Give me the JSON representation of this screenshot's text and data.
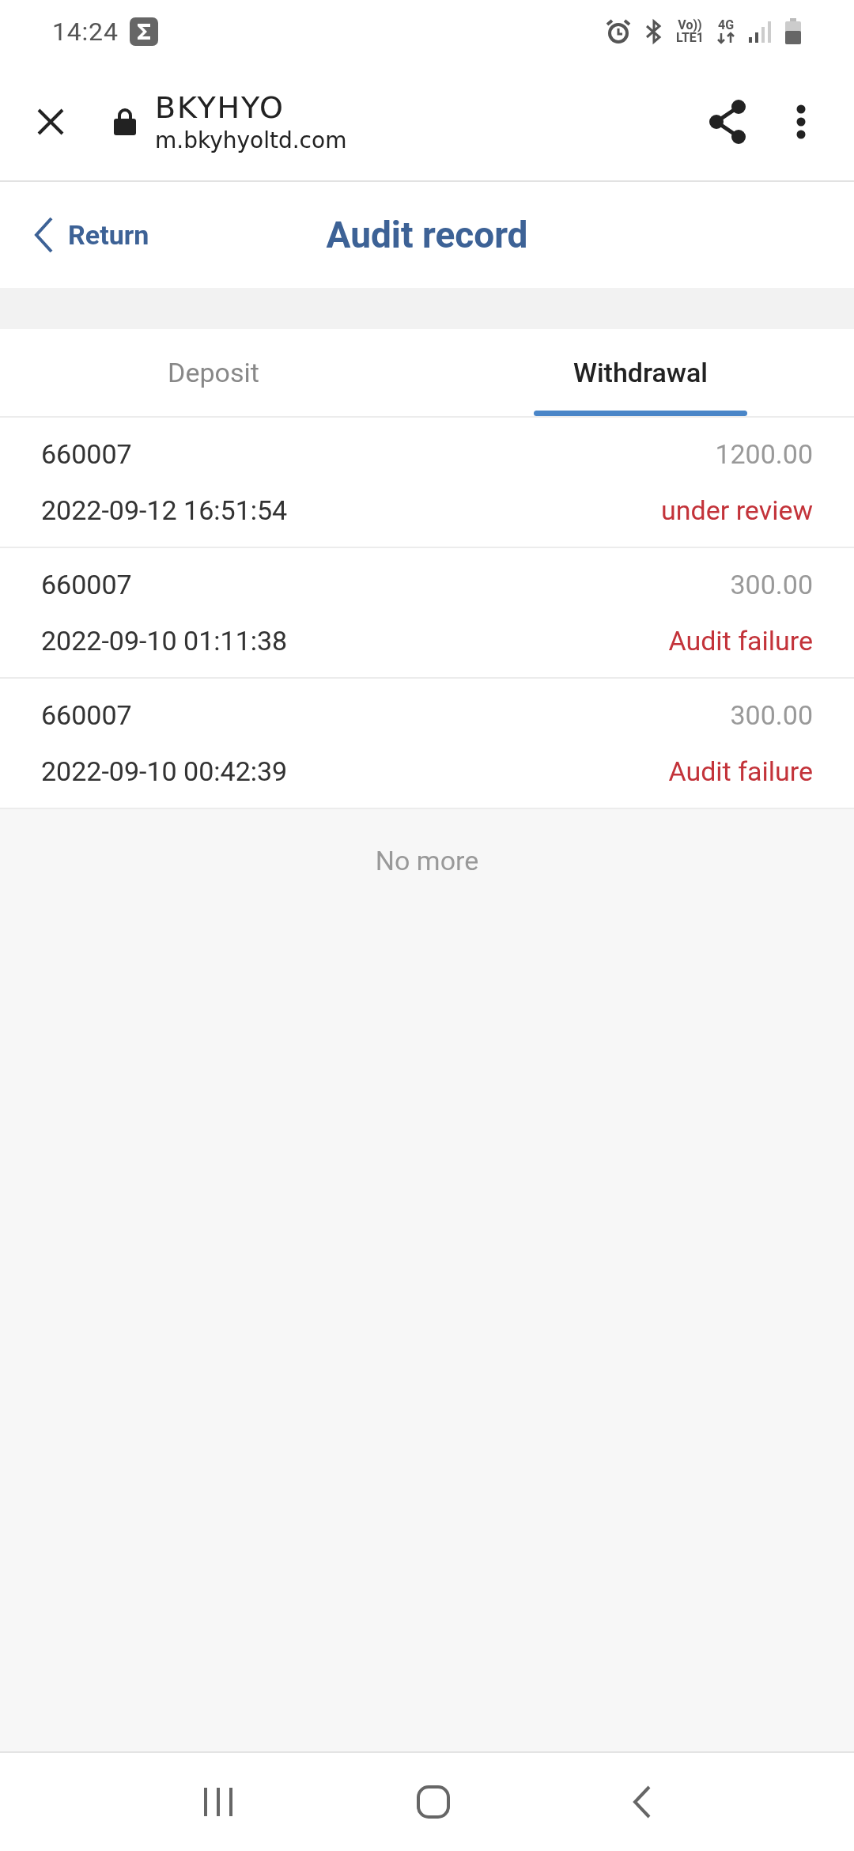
{
  "status_bar": {
    "time": "14:24",
    "volte": "Vo))",
    "lte": "LTE1",
    "network": "4G"
  },
  "browser_bar": {
    "title": "BKYHYO",
    "url": "m.bkyhyoltd.com"
  },
  "header": {
    "back": "Return",
    "title": "Audit record"
  },
  "tabs": [
    {
      "label": "Deposit",
      "selected": false
    },
    {
      "label": "Withdrawal",
      "selected": true
    }
  ],
  "records": [
    {
      "id": "660007",
      "time": "2022-09-12 16:51:54",
      "amount": "1200.00",
      "status": "under review"
    },
    {
      "id": "660007",
      "time": "2022-09-10 01:11:38",
      "amount": "300.00",
      "status": "Audit failure"
    },
    {
      "id": "660007",
      "time": "2022-09-10 00:42:39",
      "amount": "300.00",
      "status": "Audit failure"
    }
  ],
  "footer_note": "No more"
}
